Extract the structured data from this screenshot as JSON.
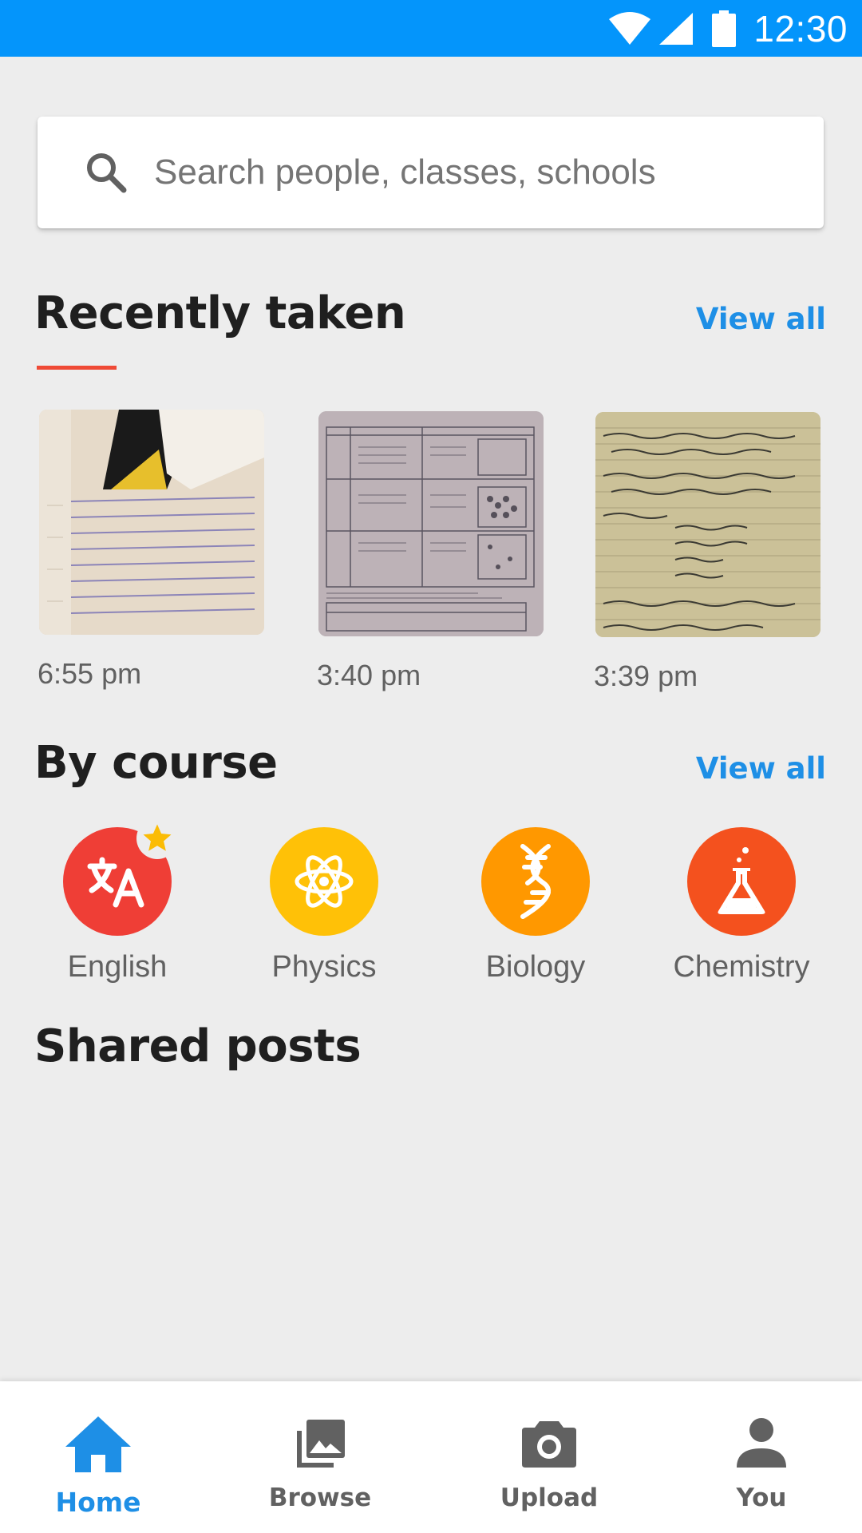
{
  "status_bar": {
    "time": "12:30"
  },
  "search": {
    "placeholder": "Search people, classes, schools"
  },
  "recently_taken": {
    "title": "Recently taken",
    "view_all": "View all",
    "items": [
      {
        "time": "6:55 pm"
      },
      {
        "time": "3:40 pm"
      },
      {
        "time": "3:39 pm"
      }
    ]
  },
  "by_course": {
    "title": "By course",
    "view_all": "View all",
    "courses": [
      {
        "label": "English",
        "color": "#ef3e36",
        "icon": "translate-icon",
        "starred": true
      },
      {
        "label": "Physics",
        "color": "#ffc107",
        "icon": "atom-icon"
      },
      {
        "label": "Biology",
        "color": "#ff9800",
        "icon": "dna-icon"
      },
      {
        "label": "Chemistry",
        "color": "#f4511e",
        "icon": "flask-icon"
      }
    ]
  },
  "shared_posts": {
    "title": "Shared posts"
  },
  "bottom_nav": {
    "items": [
      {
        "label": "Home",
        "icon": "home-icon",
        "active": true
      },
      {
        "label": "Browse",
        "icon": "photo-library-icon"
      },
      {
        "label": "Upload",
        "icon": "camera-icon"
      },
      {
        "label": "You",
        "icon": "person-icon"
      }
    ]
  },
  "colors": {
    "accent": "#1e8fe6",
    "status_bar": "#0495fb",
    "underline": "#ef4a36"
  }
}
